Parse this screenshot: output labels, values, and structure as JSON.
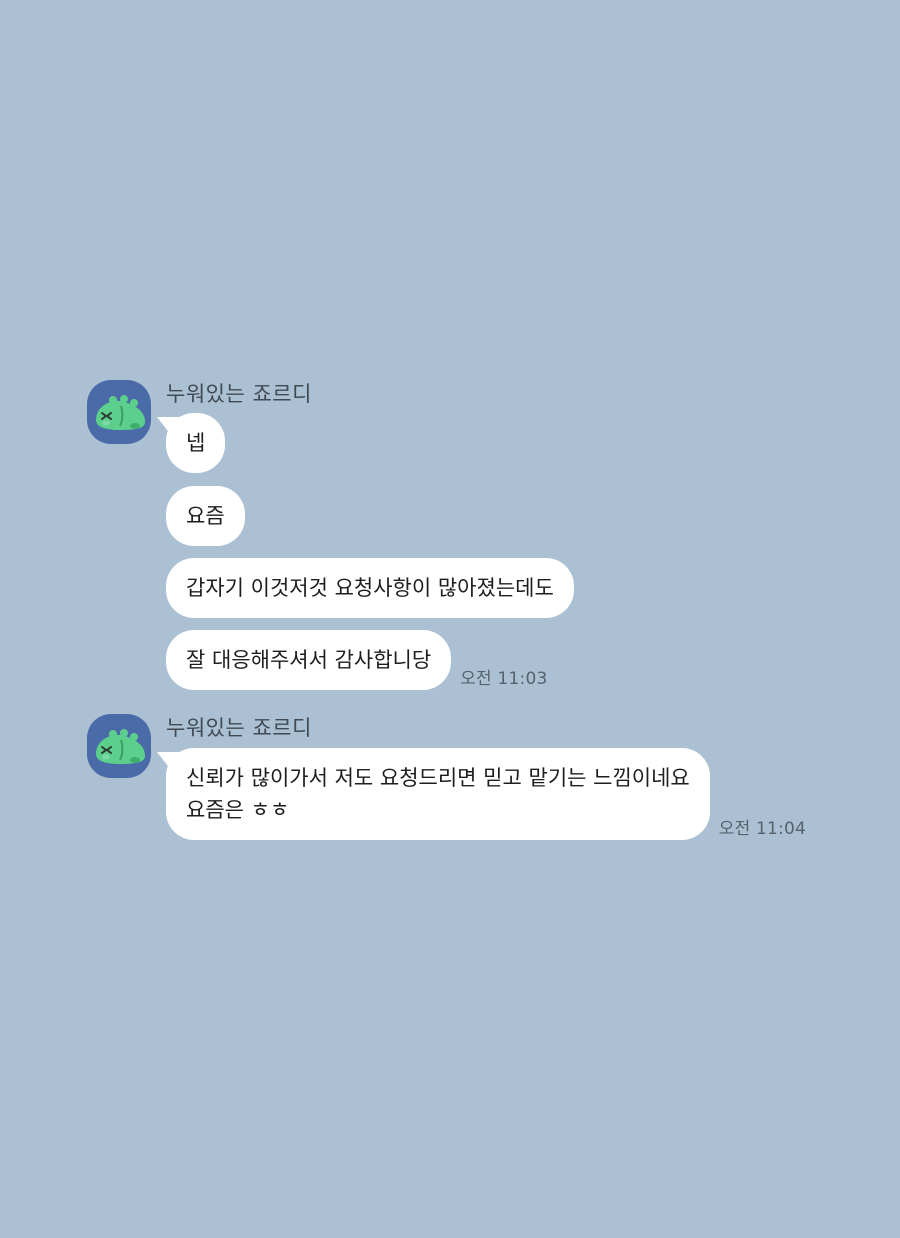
{
  "theme": {
    "background": "#abc0d2",
    "bubble": "#ffffff",
    "avatar_bg": "#4a6aa8",
    "avatar_character": "#5ccf8c"
  },
  "groups": [
    {
      "sender": "누워있는 죠르디",
      "avatar_icon": "jordy-dinosaur-icon",
      "messages": [
        {
          "text": "넵"
        },
        {
          "text": "요즘"
        },
        {
          "text": "갑자기 이것저것 요청사항이 많아졌는데도"
        },
        {
          "text": "잘 대응해주셔서 감사합니당",
          "time": "오전 11:03"
        }
      ]
    },
    {
      "sender": "누워있는 죠르디",
      "avatar_icon": "jordy-dinosaur-icon",
      "messages": [
        {
          "lines": [
            "신뢰가 많이가서 저도 요청드리면 믿고 맡기는 느낌이네요",
            "요즘은 ㅎㅎ"
          ],
          "time": "오전 11:04"
        }
      ]
    }
  ]
}
